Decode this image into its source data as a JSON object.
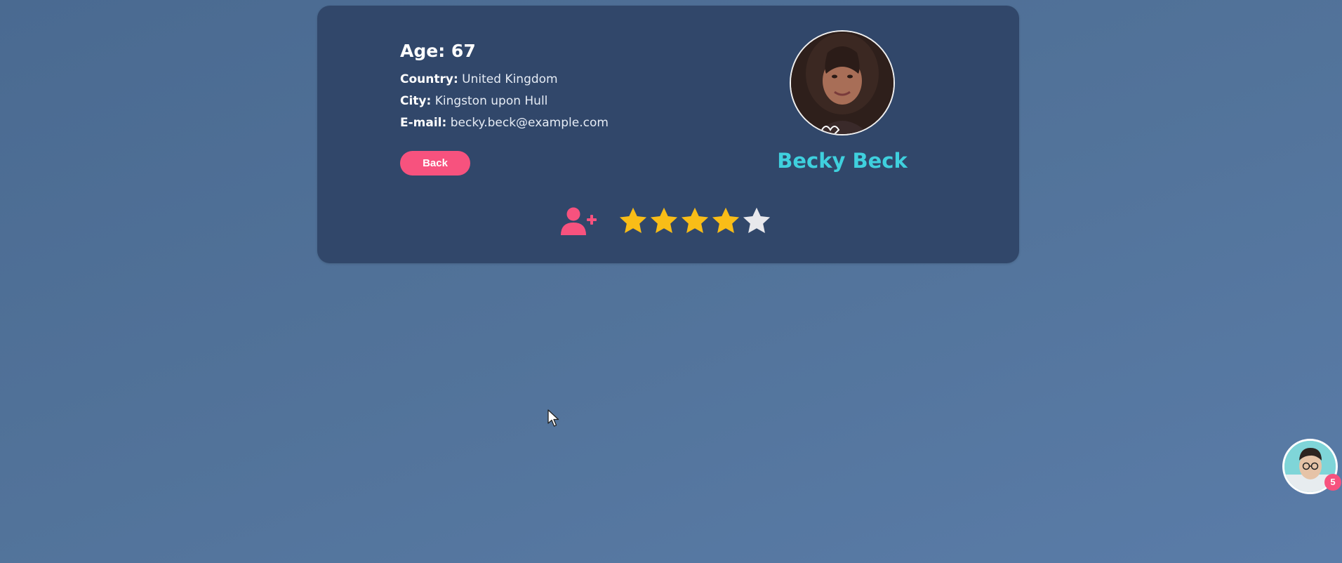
{
  "profile": {
    "age_label": "Age:",
    "age_value": "67",
    "country_label": "Country:",
    "country_value": "United Kingdom",
    "city_label": "City:",
    "city_value": "Kingston upon Hull",
    "email_label": "E-mail:",
    "email_value": "becky.beck@example.com",
    "name": "Becky Beck",
    "avatar_icon": "user-photo",
    "back_label": "Back",
    "rating": 4,
    "rating_max": 5
  },
  "chat": {
    "avatar_icon": "user-photo",
    "badge_count": "5"
  },
  "colors": {
    "accent_pink": "#f7527e",
    "name_cyan": "#3fd0de",
    "star_filled": "#f9bd17",
    "star_empty": "#e8e8ec",
    "card_bg": "#31476a"
  }
}
